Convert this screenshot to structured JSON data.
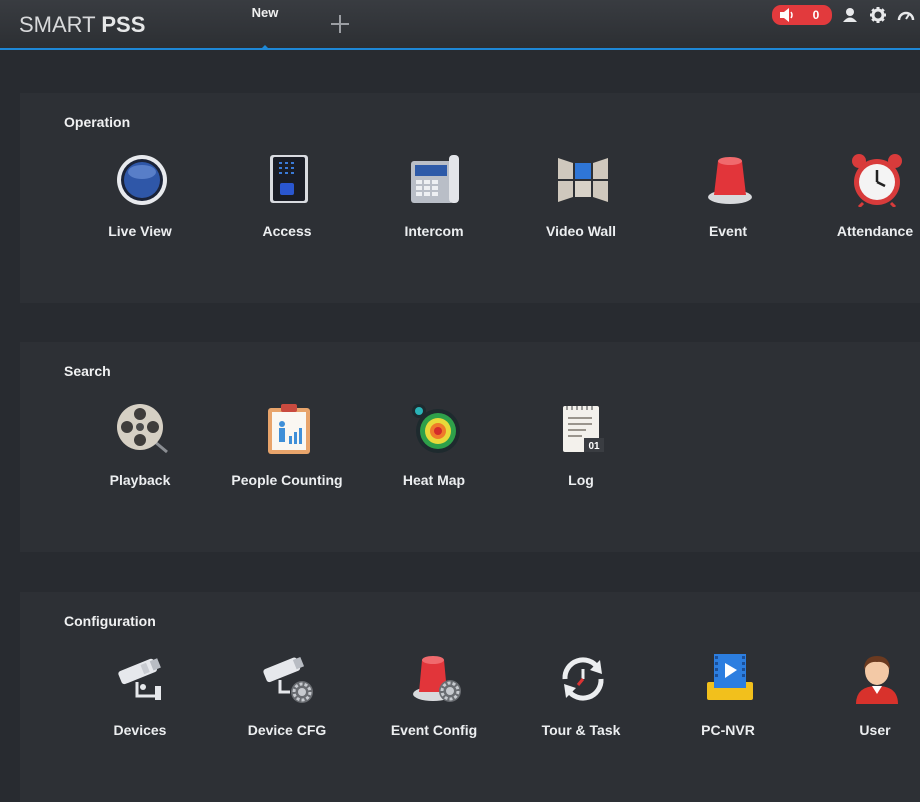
{
  "app": {
    "brand_light": "SMART",
    "brand_bold": "PSS",
    "tab_label": "New",
    "alarm_count": "0"
  },
  "header_icons": [
    "speaker-icon",
    "user-icon",
    "gear-icon",
    "dashboard-icon"
  ],
  "sections": [
    {
      "title": "Operation",
      "items": [
        {
          "label": "Live View",
          "icon": "live-view-icon"
        },
        {
          "label": "Access",
          "icon": "access-icon"
        },
        {
          "label": "Intercom",
          "icon": "intercom-icon"
        },
        {
          "label": "Video Wall",
          "icon": "video-wall-icon"
        },
        {
          "label": "Event",
          "icon": "event-icon"
        },
        {
          "label": "Attendance",
          "icon": "attendance-icon"
        }
      ]
    },
    {
      "title": "Search",
      "items": [
        {
          "label": "Playback",
          "icon": "playback-icon"
        },
        {
          "label": "People Counting",
          "icon": "people-counting-icon"
        },
        {
          "label": "Heat Map",
          "icon": "heat-map-icon"
        },
        {
          "label": "Log",
          "icon": "log-icon"
        }
      ]
    },
    {
      "title": "Configuration",
      "items": [
        {
          "label": "Devices",
          "icon": "devices-icon"
        },
        {
          "label": "Device CFG",
          "icon": "device-cfg-icon"
        },
        {
          "label": "Event Config",
          "icon": "event-config-icon"
        },
        {
          "label": "Tour & Task",
          "icon": "tour-task-icon"
        },
        {
          "label": "PC-NVR",
          "icon": "pc-nvr-icon"
        },
        {
          "label": "User",
          "icon": "user-icon"
        }
      ]
    }
  ],
  "log_badge": "01"
}
